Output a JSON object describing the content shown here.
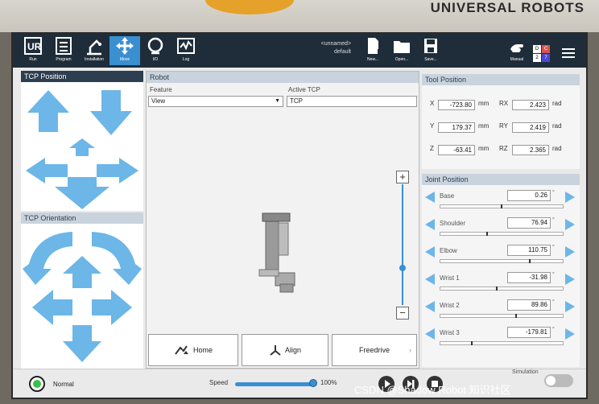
{
  "brand": "UNIVERSAL ROBOTS",
  "topbar": {
    "items": [
      {
        "label": "Run",
        "icon": "ur-logo-icon"
      },
      {
        "label": "Program",
        "icon": "program-icon"
      },
      {
        "label": "Installation",
        "icon": "installation-icon"
      },
      {
        "label": "Move",
        "icon": "move-icon",
        "active": true
      },
      {
        "label": "I/O",
        "icon": "io-icon"
      },
      {
        "label": "Log",
        "icon": "log-icon"
      }
    ],
    "program_name": "<unnamed>",
    "installation_name": "default",
    "file_buttons": [
      {
        "label": "New...",
        "icon": "new-file-icon"
      },
      {
        "label": "Open...",
        "icon": "open-folder-icon"
      },
      {
        "label": "Save...",
        "icon": "save-icon"
      }
    ],
    "manual_label": "Manual",
    "badges": [
      "D",
      "C",
      "2",
      "7"
    ]
  },
  "tcp_position": {
    "title": "TCP Position"
  },
  "tcp_orientation": {
    "title": "TCP Orientation"
  },
  "robot": {
    "title": "Robot",
    "feature_label": "Feature",
    "feature_value": "View",
    "active_tcp_label": "Active TCP",
    "active_tcp_value": "TCP",
    "home_label": "Home",
    "align_label": "Align",
    "freedrive_label": "Freedrive"
  },
  "tool_position": {
    "title": "Tool Position",
    "rows": [
      {
        "axis": "X",
        "value": "-723.80",
        "unit": "mm",
        "raxis": "RX",
        "rvalue": "2.423",
        "runit": "rad"
      },
      {
        "axis": "Y",
        "value": "179.37",
        "unit": "mm",
        "raxis": "RY",
        "rvalue": "2.419",
        "runit": "rad"
      },
      {
        "axis": "Z",
        "value": "-63.41",
        "unit": "mm",
        "raxis": "RZ",
        "rvalue": "2.365",
        "runit": "rad"
      }
    ]
  },
  "joint_position": {
    "title": "Joint Position",
    "unit": "°",
    "joints": [
      {
        "name": "Base",
        "value": "0.26",
        "fraction": 0.5
      },
      {
        "name": "Shoulder",
        "value": "76.94",
        "fraction": 0.38
      },
      {
        "name": "Elbow",
        "value": "110.75",
        "fraction": 0.73
      },
      {
        "name": "Wrist 1",
        "value": "-31.98",
        "fraction": 0.46
      },
      {
        "name": "Wrist 2",
        "value": "89.86",
        "fraction": 0.62
      },
      {
        "name": "Wrist 3",
        "value": "-179.81",
        "fraction": 0.25
      }
    ]
  },
  "bottom": {
    "status": "Normal",
    "speed_label": "Speed",
    "speed_value": "100%",
    "simulation_label": "Simulation"
  },
  "watermark": "CSDN @Shadow Robot 知识社区",
  "colors": {
    "accent": "#3a8fd0",
    "arrow": "#6cb6e8",
    "header": "#2c3e50",
    "ok": "#3cbf4a"
  }
}
